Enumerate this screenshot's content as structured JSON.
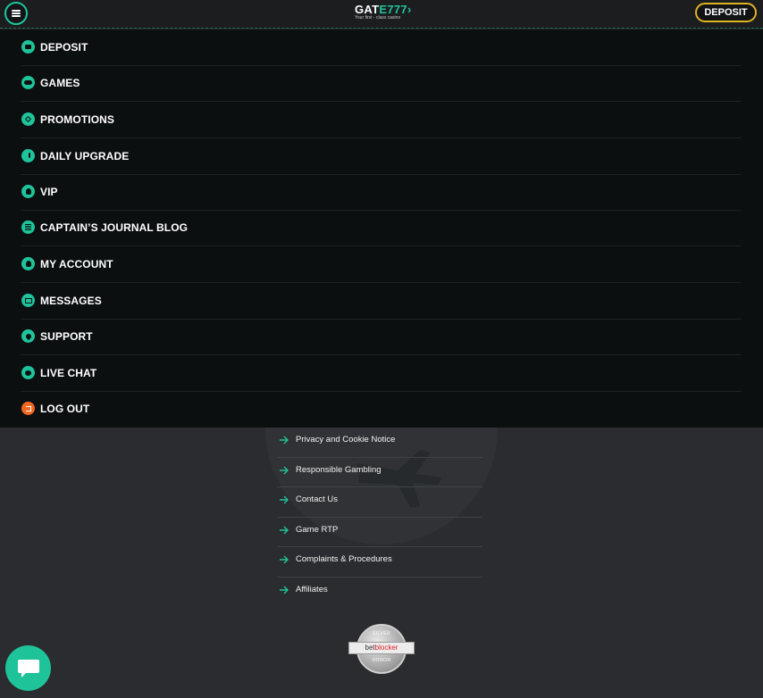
{
  "header": {
    "logo_main_white": "GAT",
    "logo_main_green": "E777",
    "logo_arrow": "›",
    "logo_tagline": "Your first - class casino",
    "deposit_label": "DEPOSIT"
  },
  "menu": {
    "items": [
      {
        "label": "DEPOSIT",
        "icon": "folder-icon"
      },
      {
        "label": "GAMES",
        "icon": "gamepad-icon"
      },
      {
        "label": "PROMOTIONS",
        "icon": "diamond-icon"
      },
      {
        "label": "DAILY UPGRADE",
        "icon": "clock-icon"
      },
      {
        "label": "VIP",
        "icon": "user-icon"
      },
      {
        "label": "CAPTAIN’S JOURNAL BLOG",
        "icon": "document-icon"
      },
      {
        "label": "MY ACCOUNT",
        "icon": "user-icon"
      },
      {
        "label": "MESSAGES",
        "icon": "mail-icon"
      },
      {
        "label": "SUPPORT",
        "icon": "location-pin-icon"
      },
      {
        "label": "LIVE CHAT",
        "icon": "chat-icon"
      },
      {
        "label": "LOG OUT",
        "icon": "logout-icon"
      }
    ]
  },
  "footer": {
    "links": [
      {
        "label": "Privacy and Cookie Notice"
      },
      {
        "label": "Responsible Gambling"
      },
      {
        "label": "Contact Us"
      },
      {
        "label": "Game RTP"
      },
      {
        "label": "Complaints & Procedures"
      },
      {
        "label": "Affiliates"
      }
    ],
    "badge": {
      "top": "SILVER",
      "brand_a": "bet",
      "brand_b": "blocker",
      "bottom": "DONOR"
    }
  },
  "colors": {
    "accent": "#1fc39a",
    "deposit_border": "#e0b323",
    "logout": "#f26722",
    "menu_bg": "#0c0f10",
    "footer_bg": "#2a2c2f"
  }
}
